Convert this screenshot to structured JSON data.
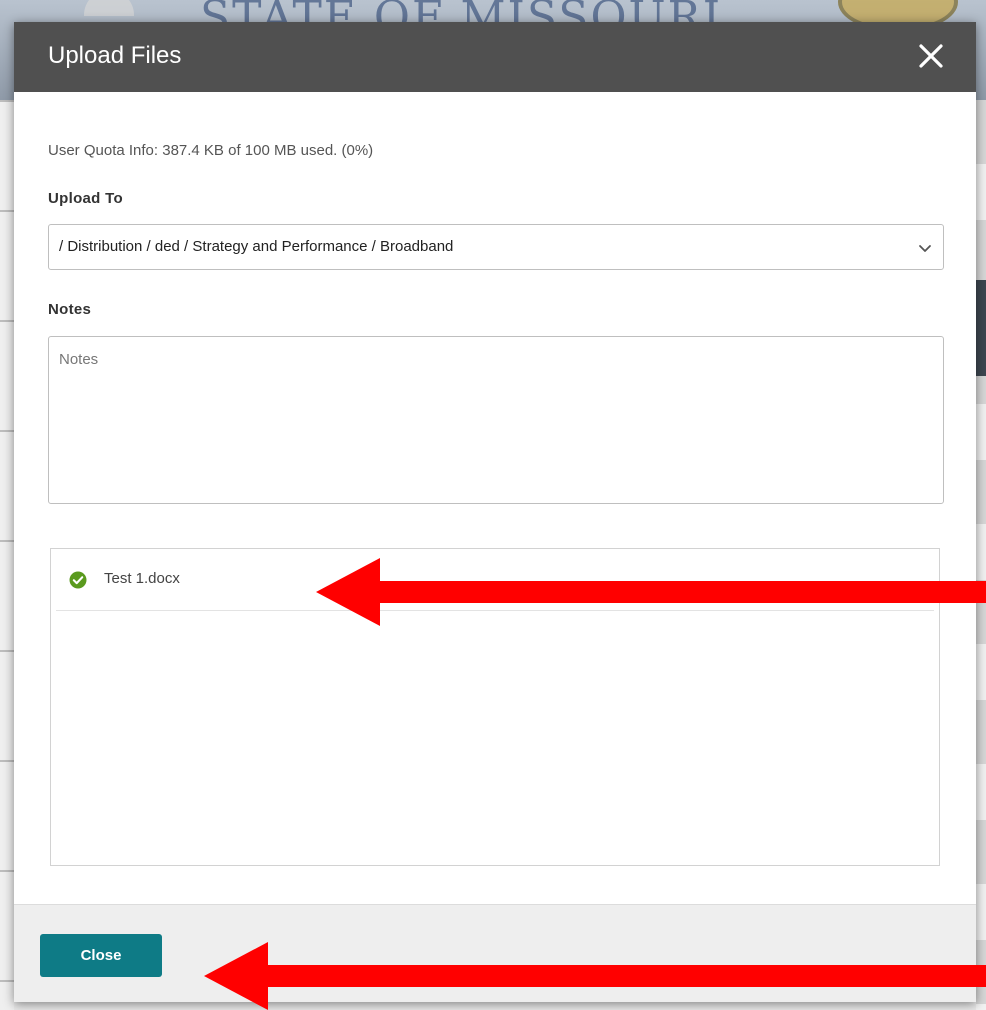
{
  "background": {
    "banner_title": "STATE OF MISSOURI"
  },
  "modal": {
    "title": "Upload Files",
    "close_icon": "close-x-icon",
    "quota_info": "User Quota Info: 387.4 KB of 100 MB used. (0%)",
    "upload_to": {
      "label": "Upload To",
      "selected_value": "/ Distribution / ded / Strategy and Performance / Broadband",
      "chevron_icon": "chevron-down-icon"
    },
    "notes": {
      "label": "Notes",
      "placeholder": "Notes",
      "value": ""
    },
    "files": [
      {
        "name": "Test 1.docx",
        "status_icon": "check-circle-icon",
        "status_color": "#5a9a1e"
      }
    ],
    "footer": {
      "close_label": "Close"
    }
  },
  "colors": {
    "header_bg": "#505050",
    "primary_button": "#0e7b86",
    "annotation_arrow": "#ff0000"
  }
}
